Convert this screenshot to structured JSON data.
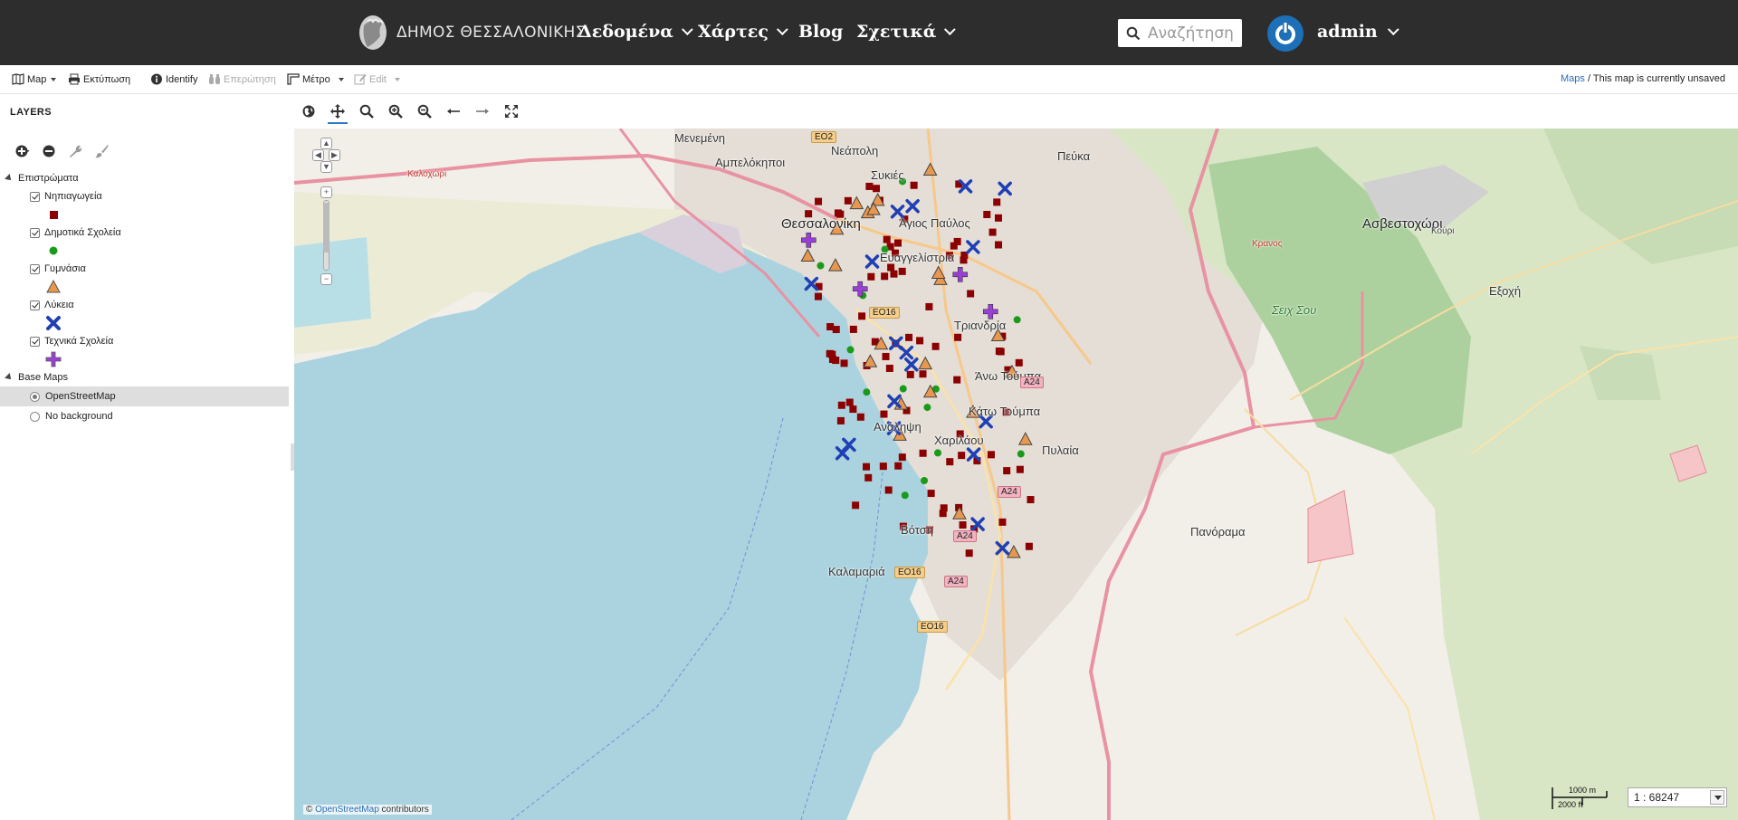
{
  "header": {
    "brand": "ΔΗΜΟΣ ΘΕΣΣΑΛΟΝΙΚΗΣ",
    "nav": [
      "Δεδομένα",
      "Χάρτες",
      "Blog",
      "Σχετικά"
    ],
    "search_placeholder": "Αναζήτηση",
    "user": "admin"
  },
  "toolbar": {
    "map": "Map",
    "print": "Εκτύπωση",
    "identify": "Identify",
    "query": "Επερώτηση",
    "measure": "Μέτρο",
    "edit": "Edit",
    "status_link": "Maps",
    "status_sep": " / ",
    "status_text": "This map is currently unsaved"
  },
  "layers": {
    "title": "LAYERS",
    "groups": [
      {
        "name": "Επιστρώματα",
        "items": [
          {
            "name": "Νηπιαγωγεία",
            "symbol": "square",
            "color": "#8b0000"
          },
          {
            "name": "Δημοτικά Σχολεία",
            "symbol": "circle",
            "color": "#1a9a1a"
          },
          {
            "name": "Γυμνάσια",
            "symbol": "triangle",
            "color": "#e8984e"
          },
          {
            "name": "Λύκεια",
            "symbol": "x",
            "color": "#1f3fb5"
          },
          {
            "name": "Τεχνικά Σχολεία",
            "symbol": "cross",
            "color": "#9a3fd6"
          }
        ]
      },
      {
        "name": "Base Maps",
        "items": [
          {
            "name": "OpenStreetMap",
            "selected": true
          },
          {
            "name": "No background",
            "selected": false
          }
        ]
      }
    ]
  },
  "map": {
    "places": [
      "Μενεμένη",
      "Αμπελόκηποι",
      "Νεάπολη",
      "Συκιές",
      "Πεύκα",
      "Θεσσαλονίκη",
      "Άγιος Παύλος",
      "Ευαγγελίστρια",
      "Ασβεστοχώρι",
      "Εξοχή",
      "Σειχ Σου",
      "Τριανδρία",
      "Άνω Τούμπα",
      "Κάτω Τούμπα",
      "Ανάληψη",
      "Χαριλάου",
      "Πυλαία",
      "Βότση",
      "Καλαμαριά",
      "Πανόραμα",
      "Κρανος",
      "Καλοχώρι",
      "Κούρι"
    ],
    "attribution_link": "OpenStreetMap",
    "attribution_text": " contributors",
    "scale_m": "1000 m",
    "scale_ft": "2000 ft",
    "scale_ratio": "1 : 68247"
  },
  "colors": {
    "sea": "#aad3df",
    "land": "#f2efe9",
    "forest": "#add19e",
    "navbar": "#2d2d2d"
  }
}
